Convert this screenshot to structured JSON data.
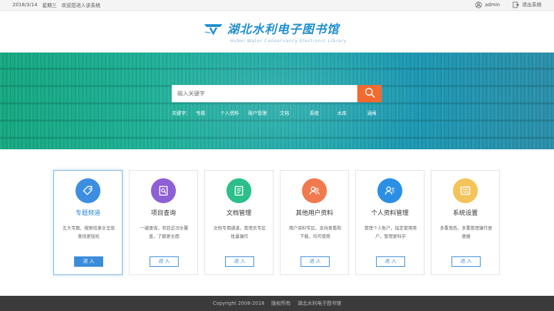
{
  "topbar": {
    "date": "2018/3/14",
    "weekday": "星期三",
    "welcome": "欢迎您进入该系统",
    "user": "admin",
    "logout": "退出系统"
  },
  "header": {
    "title": "湖北水利电子图书馆",
    "subtitle": "Hubei Water Conservancy Electronic Library"
  },
  "search": {
    "placeholder": "输入关键字",
    "keywords_label": "关键字：",
    "keywords": [
      "专题",
      "个人资料",
      "用户管理",
      "文档",
      "系统",
      "水库",
      "涵闸"
    ]
  },
  "cards": [
    {
      "title": "专题频道",
      "desc": "五大专题，搜索结果全呈现查找更轻松",
      "button": "进 入",
      "icon": "tag-icon",
      "color": "#3d8ee0"
    },
    {
      "title": "项目查询",
      "desc": "一键查询，项目近况全覆盖，了解更全面",
      "button": "进 入",
      "icon": "document-search-icon",
      "color": "#8f5fd6"
    },
    {
      "title": "文档管理",
      "desc": "文档专用通道，管理员专区批量操作",
      "button": "进 入",
      "icon": "file-icon",
      "color": "#2bbf8a"
    },
    {
      "title": "其他用户资料",
      "desc": "用户资料专区，支持查看和下载，均可使用",
      "button": "进 入",
      "icon": "users-icon",
      "color": "#f07a4e"
    },
    {
      "title": "个人资料管理",
      "desc": "管理个人账户，指定使用用户，管理更科学",
      "button": "进 入",
      "icon": "user-profile-icon",
      "color": "#2b8fe6"
    },
    {
      "title": "系统设置",
      "desc": "多重角色，多重管理操作更便捷",
      "button": "进 入",
      "icon": "settings-panel-icon",
      "color": "#f4c45a"
    }
  ],
  "footer": {
    "copyright": "Copyright   2008-2018",
    "rights": "版权所有",
    "owner": "湖北水利电子图书馆"
  }
}
